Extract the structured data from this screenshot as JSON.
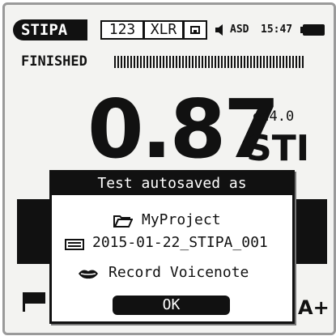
{
  "status_bar": {
    "mode": "STIPA",
    "input_chip": "123",
    "connector_chip": "XLR",
    "memory_icon": "memory-card-icon",
    "speaker_icon": "speaker-icon",
    "asd_label": "ASD",
    "time": "15:47",
    "battery_icon": "battery-icon"
  },
  "measurement": {
    "status": "FINISHED",
    "progress": 1.0,
    "value": "0.87",
    "version": "ed4.0",
    "unit": "STI"
  },
  "background": {
    "partial_label": "A+"
  },
  "dialog": {
    "title": "Test autosaved as",
    "project_icon": "folder-icon",
    "project": "MyProject",
    "file_icon": "file-icon",
    "filename": "2015-01-22_STIPA_001",
    "voicenote_icon": "lips-icon",
    "voicenote": "Record Voicenote",
    "ok": "OK"
  },
  "colors": {
    "ink": "#111111",
    "screen": "#f3f3f1",
    "bezel": "#9a9a9a"
  }
}
